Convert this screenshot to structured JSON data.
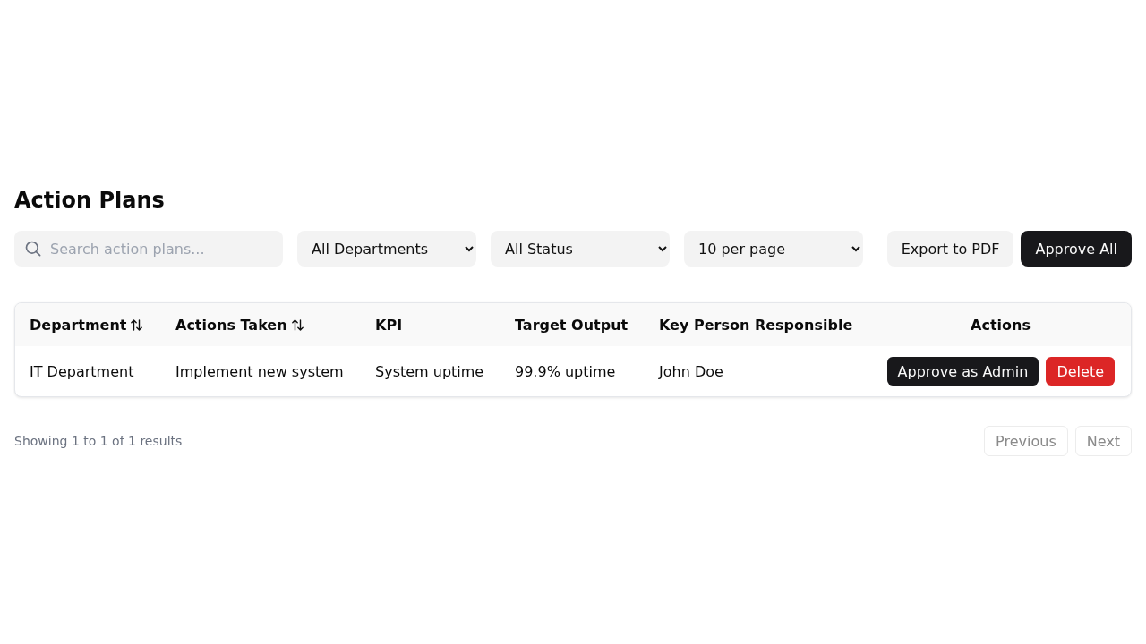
{
  "title": "Action Plans",
  "toolbar": {
    "search": {
      "placeholder": "Search action plans..."
    },
    "filters": [
      {
        "value": "All Departments"
      },
      {
        "value": "All Status"
      },
      {
        "value": "10 per page"
      }
    ],
    "buttons": [
      {
        "label": "Export to PDF",
        "kind": "secondary"
      },
      {
        "label": "Approve All",
        "kind": "primary"
      }
    ]
  },
  "table": {
    "columns": [
      {
        "label": "Department",
        "sortable": true
      },
      {
        "label": "Actions Taken",
        "sortable": true
      },
      {
        "label": "KPI",
        "sortable": false
      },
      {
        "label": "Target Output",
        "sortable": false
      },
      {
        "label": "Key Person Responsible",
        "sortable": false
      },
      {
        "label": "Actions",
        "sortable": false
      }
    ],
    "rows": [
      {
        "cells": [
          "IT Department",
          "Implement new system",
          "System uptime",
          "99.9% uptime",
          "John Doe"
        ],
        "actions": [
          {
            "label": "Approve as Admin",
            "kind": "primary"
          },
          {
            "label": "Delete",
            "kind": "danger"
          }
        ]
      }
    ]
  },
  "footer": {
    "summary": "Showing 1 to 1 of 1 results",
    "pagination": [
      {
        "label": "Previous",
        "disabled": true
      },
      {
        "label": "Next",
        "disabled": true
      }
    ]
  }
}
